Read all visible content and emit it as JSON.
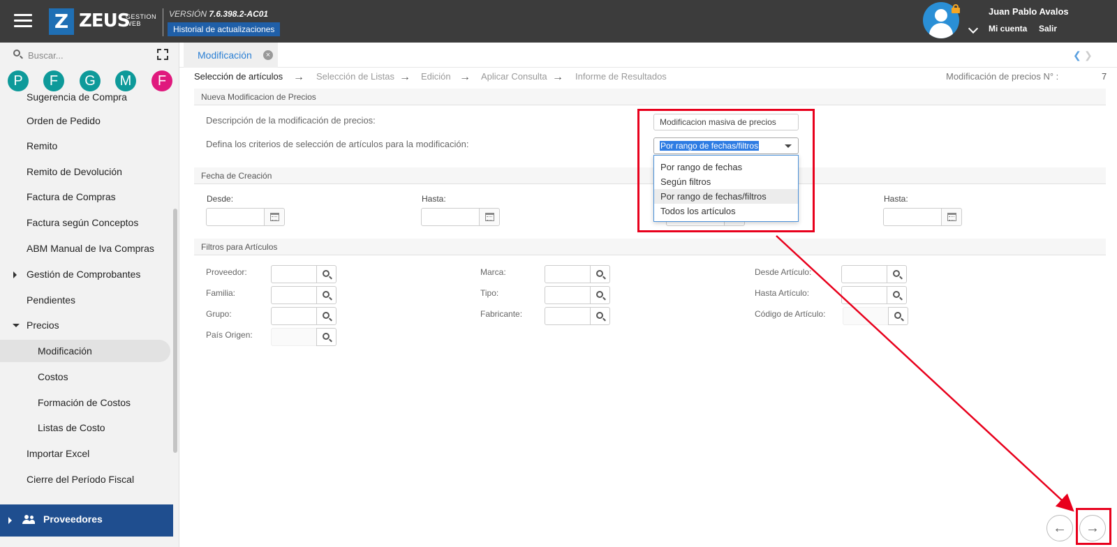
{
  "header": {
    "logo_letter": "Z",
    "logo_name": "ZEUS",
    "logo_sub_1": "GESTION",
    "logo_sub_2": "WEB",
    "version_prefix": "VERSIÓN",
    "version_number": "7.6.398.2-AC01",
    "history_label": "Historial de actualizaciones",
    "user_name": "Juan Pablo Avalos",
    "account_label": "Mi cuenta",
    "logout_label": "Salir",
    "accent_color": "#1f6fb4"
  },
  "sidebar": {
    "search_placeholder": "Buscar...",
    "quick_access": [
      {
        "letter": "P",
        "color": "#0e9a9a"
      },
      {
        "letter": "F",
        "color": "#0e9a9a"
      },
      {
        "letter": "G",
        "color": "#0e9a9a"
      },
      {
        "letter": "M",
        "color": "#0e9a9a"
      },
      {
        "letter": "F",
        "color": "#e0197d"
      }
    ],
    "items": [
      {
        "label": "Sugerencia de Compra"
      },
      {
        "label": "Orden de Pedido"
      },
      {
        "label": "Remito"
      },
      {
        "label": "Remito de Devolución"
      },
      {
        "label": "Factura de Compras"
      },
      {
        "label": "Factura según Conceptos"
      },
      {
        "label": "ABM Manual de Iva Compras"
      },
      {
        "label": "Gestión de Comprobantes"
      },
      {
        "label": "Pendientes"
      },
      {
        "label": "Precios"
      },
      {
        "label": "Modificación"
      },
      {
        "label": "Costos"
      },
      {
        "label": "Formación de Costos"
      },
      {
        "label": "Listas de Costo"
      },
      {
        "label": "Importar Excel"
      },
      {
        "label": "Cierre del Período Fiscal"
      }
    ],
    "footer_label": "Proveedores"
  },
  "tab": {
    "label": "Modificación",
    "close": "×"
  },
  "wizard": {
    "steps": [
      "Selección de artículos",
      "Selección de Listas",
      "Edición",
      "Aplicar Consulta",
      "Informe de Resultados"
    ],
    "arrow": "→",
    "number_label": "Modificación de precios N° :",
    "number_value": "7"
  },
  "form": {
    "section_new": "Nueva Modificacion de Precios",
    "description_label": "Descripción de la modificación de precios:",
    "description_value": "Modificacion masiva de precios",
    "criteria_label": "Defina los criterios de selección de artículos para la modificación:",
    "criteria_selected": "Por rango de fechas/filtros",
    "criteria_options": [
      "Por rango de fechas",
      "Según filtros",
      "Por rango de fechas/filtros",
      "Todos los artículos"
    ],
    "section_date": "Fecha de Creación",
    "from_label": "Desde:",
    "to_label": "Hasta:",
    "section_filters": "Filtros para Artículos",
    "filters": {
      "proveedor": "Proveedor:",
      "familia": "Familia:",
      "grupo": "Grupo:",
      "pais_origen": "País Origen:",
      "marca": "Marca:",
      "tipo": "Tipo:",
      "fabricante": "Fabricante:",
      "desde_articulo": "Desde Artículo:",
      "hasta_articulo": "Hasta Artículo:",
      "codigo_articulo": "Código de Artículo:"
    }
  },
  "nav": {
    "prev": "←",
    "next": "→"
  },
  "annotation_color": "#e8001c"
}
